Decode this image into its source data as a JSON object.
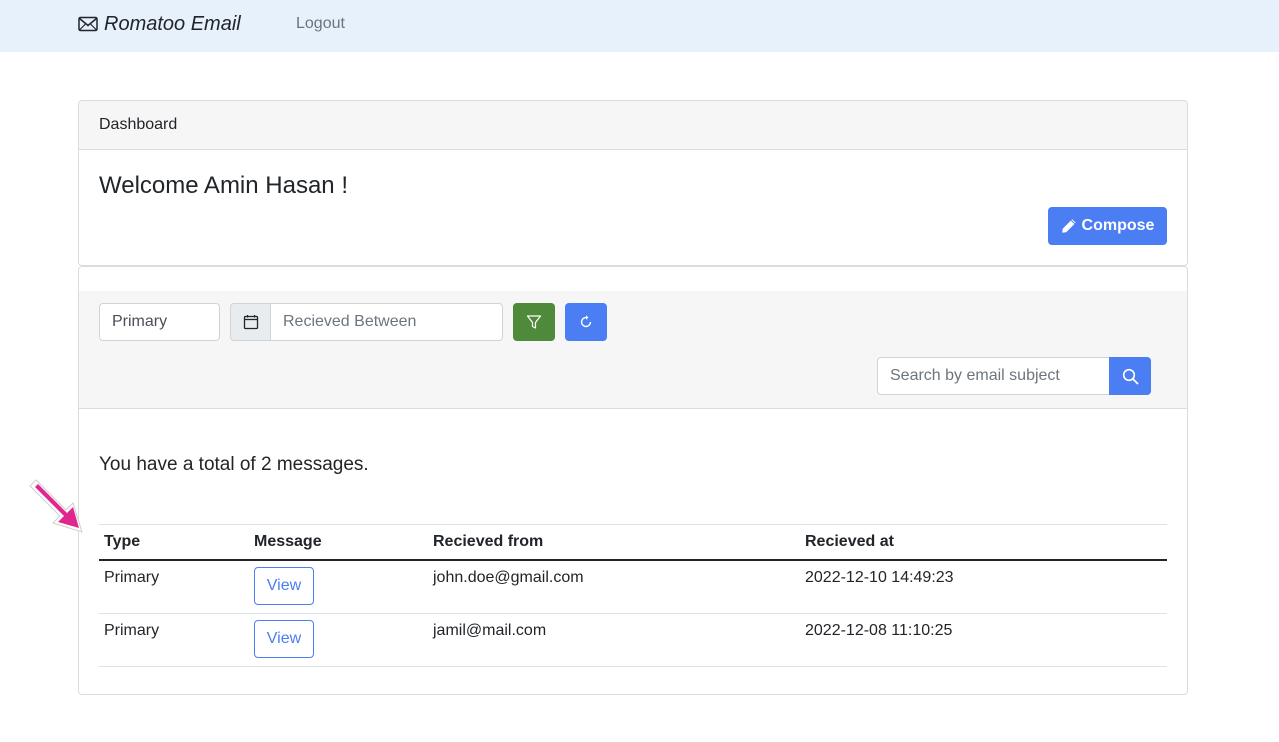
{
  "navbar": {
    "brand": "Romatoo Email",
    "brand_icon": "envelope-icon",
    "logout_label": "Logout"
  },
  "dashboard": {
    "header": "Dashboard",
    "welcome": "Welcome Amin Hasan !",
    "compose_label": "Compose",
    "compose_icon": "pencil-icon"
  },
  "filters": {
    "type_value": "Primary",
    "date_placeholder": "Recieved Between",
    "search_placeholder": "Search by email subject"
  },
  "messages": {
    "total_text": "You have a total of 2 messages.",
    "columns": [
      "Type",
      "Message",
      "Recieved from",
      "Recieved at"
    ],
    "rows": [
      {
        "type": "Primary",
        "action": "View",
        "from": "john.doe@gmail.com",
        "at": "2022-12-10 14:49:23"
      },
      {
        "type": "Primary",
        "action": "View",
        "from": "jamil@mail.com",
        "at": "2022-12-08 11:10:25"
      }
    ]
  },
  "colors": {
    "navbar_bg": "#e7f1fb",
    "primary": "#4b7df3",
    "success": "#4e8a3a",
    "annotation_arrow": "#e0268f"
  }
}
